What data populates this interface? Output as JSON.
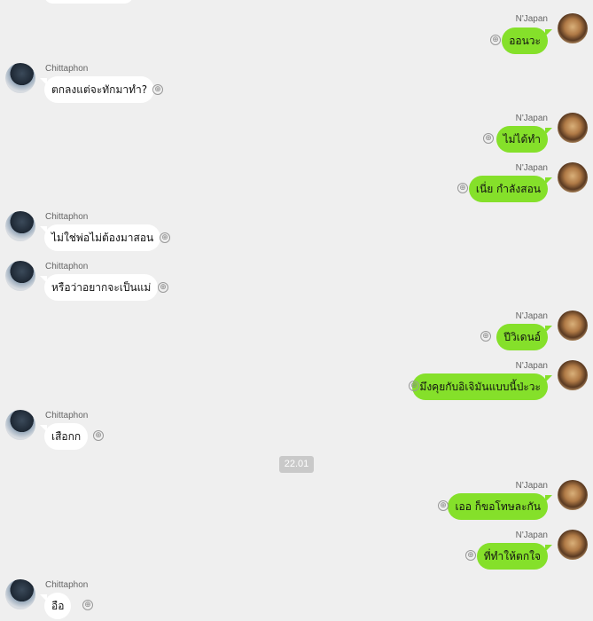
{
  "chat": {
    "time_divider": "22.01",
    "messages": [
      {
        "sender": "N'Japan",
        "side": "me",
        "text": "ออนวะ"
      },
      {
        "sender": "Chittaphon",
        "side": "them",
        "text": "ตกลงแต่จะทักมาทำ?"
      },
      {
        "sender": "N'Japan",
        "side": "me",
        "text": "ไม่ได้ทำ"
      },
      {
        "sender": "N'Japan",
        "side": "me",
        "text": "เนี่ย กำลังสอน"
      },
      {
        "sender": "Chittaphon",
        "side": "them",
        "text": "ไม่ใช่พ่อไม่ต้องมาสอน"
      },
      {
        "sender": "Chittaphon",
        "side": "them",
        "text": "หรือว่าอยากจะเป็นแม่"
      },
      {
        "sender": "N'Japan",
        "side": "me",
        "text": "ปีวิเดนอ์"
      },
      {
        "sender": "N'Japan",
        "side": "me",
        "text": "มึงคุยกับอิเจิมันแบบนี้ป่ะวะ"
      },
      {
        "sender": "Chittaphon",
        "side": "them",
        "text": "เสือกก"
      },
      {
        "sender": "N'Japan",
        "side": "me",
        "text": "เออ ก็ขอโทษละกัน"
      },
      {
        "sender": "N'Japan",
        "side": "me",
        "text": "ที่ทำให้ตกใจ"
      },
      {
        "sender": "Chittaphon",
        "side": "them",
        "text": "อือ"
      }
    ]
  },
  "icons": {
    "react": "add-reaction-icon",
    "reply_symbol": "⊕"
  }
}
